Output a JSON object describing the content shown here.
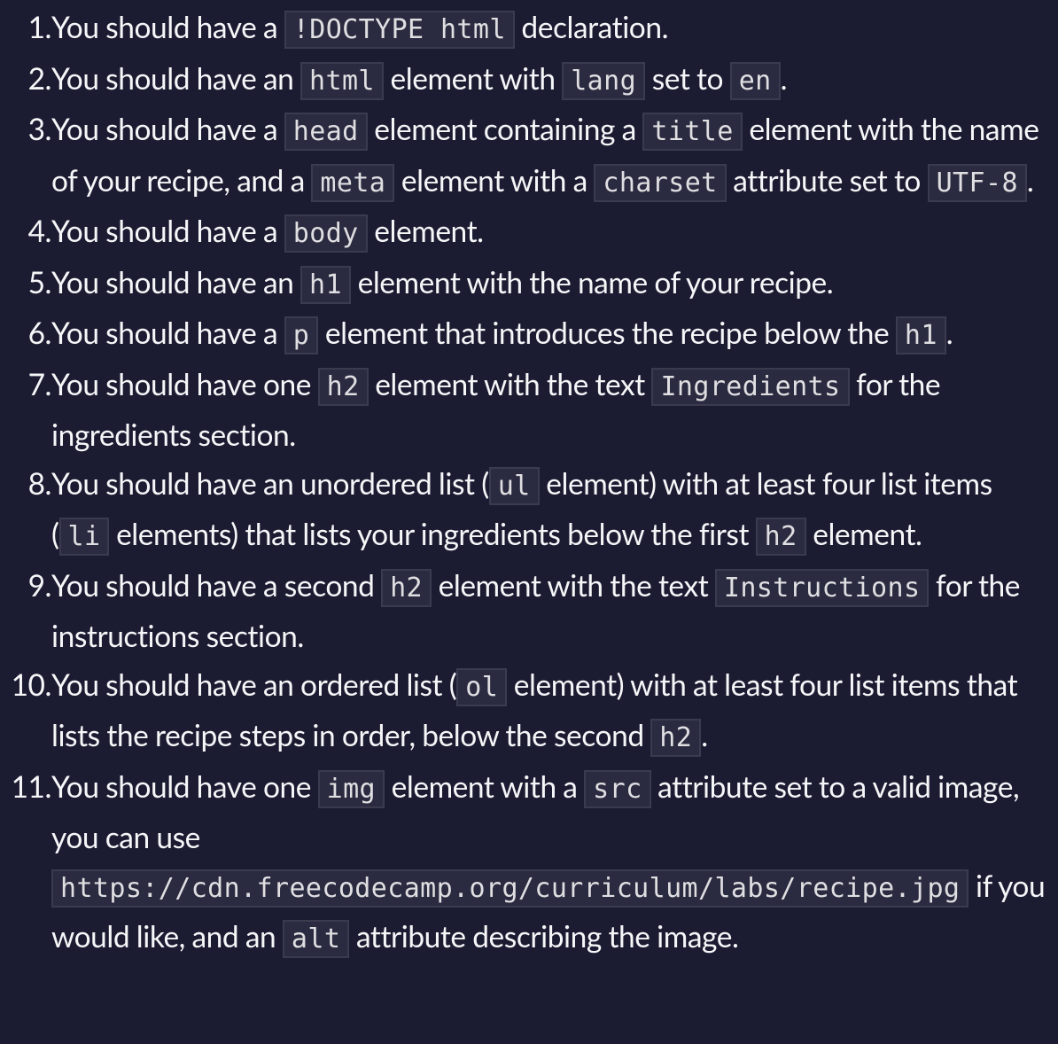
{
  "requirements": [
    {
      "number": "1.",
      "parts": [
        {
          "type": "text",
          "value": "You should have a "
        },
        {
          "type": "code",
          "value": "!DOCTYPE html"
        },
        {
          "type": "text",
          "value": " declaration."
        }
      ]
    },
    {
      "number": "2.",
      "parts": [
        {
          "type": "text",
          "value": "You should have an "
        },
        {
          "type": "code",
          "value": "html"
        },
        {
          "type": "text",
          "value": " element with "
        },
        {
          "type": "code",
          "value": "lang"
        },
        {
          "type": "text",
          "value": " set to "
        },
        {
          "type": "code",
          "value": "en"
        },
        {
          "type": "text",
          "value": "."
        }
      ]
    },
    {
      "number": "3.",
      "parts": [
        {
          "type": "text",
          "value": "You should have a "
        },
        {
          "type": "code",
          "value": "head"
        },
        {
          "type": "text",
          "value": " element containing a "
        },
        {
          "type": "code",
          "value": "title"
        },
        {
          "type": "text",
          "value": " element with the name of your recipe, and a "
        },
        {
          "type": "code",
          "value": "meta"
        },
        {
          "type": "text",
          "value": " element with a "
        },
        {
          "type": "code",
          "value": "charset"
        },
        {
          "type": "text",
          "value": " attribute set to "
        },
        {
          "type": "code",
          "value": "UTF-8"
        },
        {
          "type": "text",
          "value": "."
        }
      ]
    },
    {
      "number": "4.",
      "parts": [
        {
          "type": "text",
          "value": "You should have a "
        },
        {
          "type": "code",
          "value": "body"
        },
        {
          "type": "text",
          "value": " element."
        }
      ]
    },
    {
      "number": "5.",
      "parts": [
        {
          "type": "text",
          "value": "You should have an "
        },
        {
          "type": "code",
          "value": "h1"
        },
        {
          "type": "text",
          "value": " element with the name of your recipe."
        }
      ]
    },
    {
      "number": "6.",
      "parts": [
        {
          "type": "text",
          "value": "You should have a "
        },
        {
          "type": "code",
          "value": "p"
        },
        {
          "type": "text",
          "value": " element that introduces the recipe below the "
        },
        {
          "type": "code",
          "value": "h1"
        },
        {
          "type": "text",
          "value": "."
        }
      ]
    },
    {
      "number": "7.",
      "parts": [
        {
          "type": "text",
          "value": "You should have one "
        },
        {
          "type": "code",
          "value": "h2"
        },
        {
          "type": "text",
          "value": " element with the text "
        },
        {
          "type": "code",
          "value": "Ingredients"
        },
        {
          "type": "text",
          "value": " for the ingredients section."
        }
      ]
    },
    {
      "number": "8.",
      "parts": [
        {
          "type": "text",
          "value": "You should have an unordered list ("
        },
        {
          "type": "code",
          "value": "ul"
        },
        {
          "type": "text",
          "value": " element) with at least four list items ("
        },
        {
          "type": "code",
          "value": "li"
        },
        {
          "type": "text",
          "value": " elements) that lists your ingredients below the first "
        },
        {
          "type": "code",
          "value": "h2"
        },
        {
          "type": "text",
          "value": " element."
        }
      ]
    },
    {
      "number": "9.",
      "parts": [
        {
          "type": "text",
          "value": "You should have a second "
        },
        {
          "type": "code",
          "value": "h2"
        },
        {
          "type": "text",
          "value": " element with the text "
        },
        {
          "type": "code",
          "value": "Instructions"
        },
        {
          "type": "text",
          "value": " for the instructions section."
        }
      ]
    },
    {
      "number": "10.",
      "parts": [
        {
          "type": "text",
          "value": "You should have an ordered list ("
        },
        {
          "type": "code",
          "value": "ol"
        },
        {
          "type": "text",
          "value": " element) with at least four list items that lists the recipe steps in order, below the second "
        },
        {
          "type": "code",
          "value": "h2"
        },
        {
          "type": "text",
          "value": "."
        }
      ]
    },
    {
      "number": "11.",
      "parts": [
        {
          "type": "text",
          "value": "You should have one "
        },
        {
          "type": "code",
          "value": "img"
        },
        {
          "type": "text",
          "value": " element with a "
        },
        {
          "type": "code",
          "value": "src"
        },
        {
          "type": "text",
          "value": " attribute set to a valid image, you can use "
        },
        {
          "type": "code",
          "value": "https://cdn.freecodecamp.org/curriculum/labs/recipe.jpg"
        },
        {
          "type": "text",
          "value": " if you would like, and an "
        },
        {
          "type": "code",
          "value": "alt"
        },
        {
          "type": "text",
          "value": " attribute describing the image."
        }
      ]
    }
  ]
}
